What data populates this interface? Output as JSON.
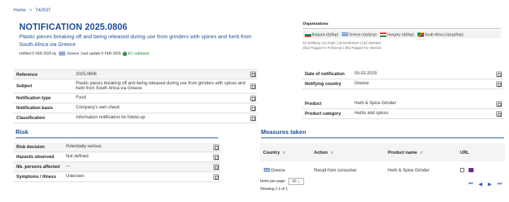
{
  "breadcrumb": {
    "home": "Home",
    "sep": ">",
    "current": "742537"
  },
  "notification": {
    "title": "NOTIFICATION 2025.0806",
    "subtitle": "Plastic pieces breaking off and being released during use from grinders with spices and herb from South Africa via Greece",
    "meta_prefix": "notified 5 FEB 2025 by",
    "meta_country": "Greece",
    "meta_update": "| last update 5 FEB 2025",
    "meta_status": "EC-validated"
  },
  "organisations": {
    "header": "Organisations",
    "items": [
      {
        "flag": "bg",
        "label": "Bulgaria (d)(flup)"
      },
      {
        "flag": "gr",
        "label": "Greece (n)(d)(op)"
      },
      {
        "flag": "hu",
        "label": "Hungary (d)(flup)"
      },
      {
        "flag": "za",
        "label": "South Africa (o)(op)(flup)"
      }
    ],
    "legend1": "(n) Notifying | (o) Origin | (d) Distribution | (op) Operator",
    "legend2": "(flup) Flagged for Follow-Up | (ffa) Flagged For Attention"
  },
  "details_left": [
    {
      "label": "Reference",
      "value": "2025.0806"
    },
    {
      "label": "Subject",
      "value": "Plastic pieces breaking off and being released during use from grinders with spices and herb from South Africa via Greece"
    },
    {
      "label": "Notification type",
      "value": "Food"
    },
    {
      "label": "Notification basis",
      "value": "Company's own check"
    },
    {
      "label": "Classification",
      "value": "Information notification for follow-up"
    }
  ],
  "details_right": [
    {
      "label": "Date of notification",
      "value": "05-02-2025"
    },
    {
      "label": "Notifying country",
      "value": "Greece"
    },
    {
      "label": "Product",
      "value": "Herb & Spice Grinder"
    },
    {
      "label": "Product category",
      "value": "Herbs and spices"
    }
  ],
  "risk": {
    "title": "Risk",
    "rows": [
      {
        "label": "Risk decision",
        "value": "Potentially serious"
      },
      {
        "label": "Hazards observed",
        "value": "Not defined"
      },
      {
        "label": "Nb. persons affected",
        "value": "---"
      },
      {
        "label": "Symptoms / Illness",
        "value": "Unknown"
      }
    ]
  },
  "measures": {
    "title": "Measures taken",
    "columns": [
      "Country",
      "Action",
      "Product name",
      "URL"
    ],
    "rows": [
      {
        "country": "Greece",
        "action": "Recall from consumer",
        "product": "Herb & Spice Grinder"
      }
    ],
    "items_per_page_label": "Items per page:",
    "items_per_page": "10",
    "showing": "Showing 1-1 of 1"
  }
}
